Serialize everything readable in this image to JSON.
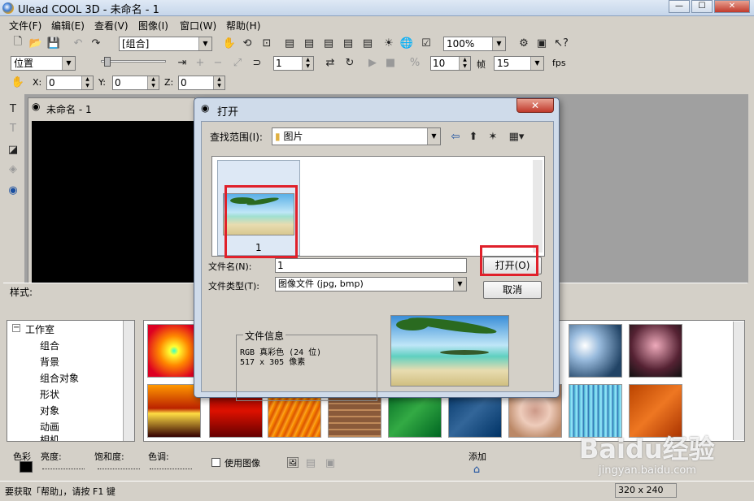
{
  "window": {
    "title": "Ulead COOL 3D - 未命名 - 1"
  },
  "menu": [
    "文件(F)",
    "编辑(E)",
    "查看(V)",
    "图像(I)",
    "窗口(W)",
    "帮助(H)"
  ],
  "toolbar1": {
    "object_select": "[组合]",
    "zoom": "100%"
  },
  "toolbar2": {
    "mode": "位置",
    "frame": "1",
    "frames_total": "10",
    "frame_label": "帧",
    "fps_value": "15",
    "fps_label": "fps"
  },
  "toolbar3": {
    "x_label": "X:",
    "x": "0",
    "y_label": "Y:",
    "y": "0",
    "z_label": "Z:",
    "z": "0"
  },
  "document": {
    "title": "未命名 - 1"
  },
  "style_label": "样式:",
  "tree": {
    "root": "工作室",
    "items": [
      "组合",
      "背景",
      "组合对象",
      "形状",
      "对象",
      "动画",
      "相机"
    ]
  },
  "bottom": {
    "color_label": "色彩",
    "brightness_label": "亮度:",
    "saturation_label": "饱和度:",
    "hue_label": "色调:",
    "use_image_label": "使用图像",
    "add_label": "添加"
  },
  "status": {
    "hint": "要获取「帮助」，请按 F1 键",
    "size": "320 x 240"
  },
  "dialog": {
    "title": "打开",
    "look_in_label": "查找范围(I):",
    "look_in_value": "图片",
    "file_item_label": "1",
    "filename_label": "文件名(N):",
    "filename_value": "1",
    "filetype_label": "文件类型(T):",
    "filetype_value": "图像文件 (jpg, bmp)",
    "open_button": "打开(O)",
    "cancel_button": "取消",
    "info_title": "文件信息",
    "info_line1": "RGB 真彩色 (24 位)",
    "info_line2": "517 x 305 像素"
  },
  "watermark": {
    "text": "Baidu经验",
    "url": "jingyan.baidu.com"
  }
}
